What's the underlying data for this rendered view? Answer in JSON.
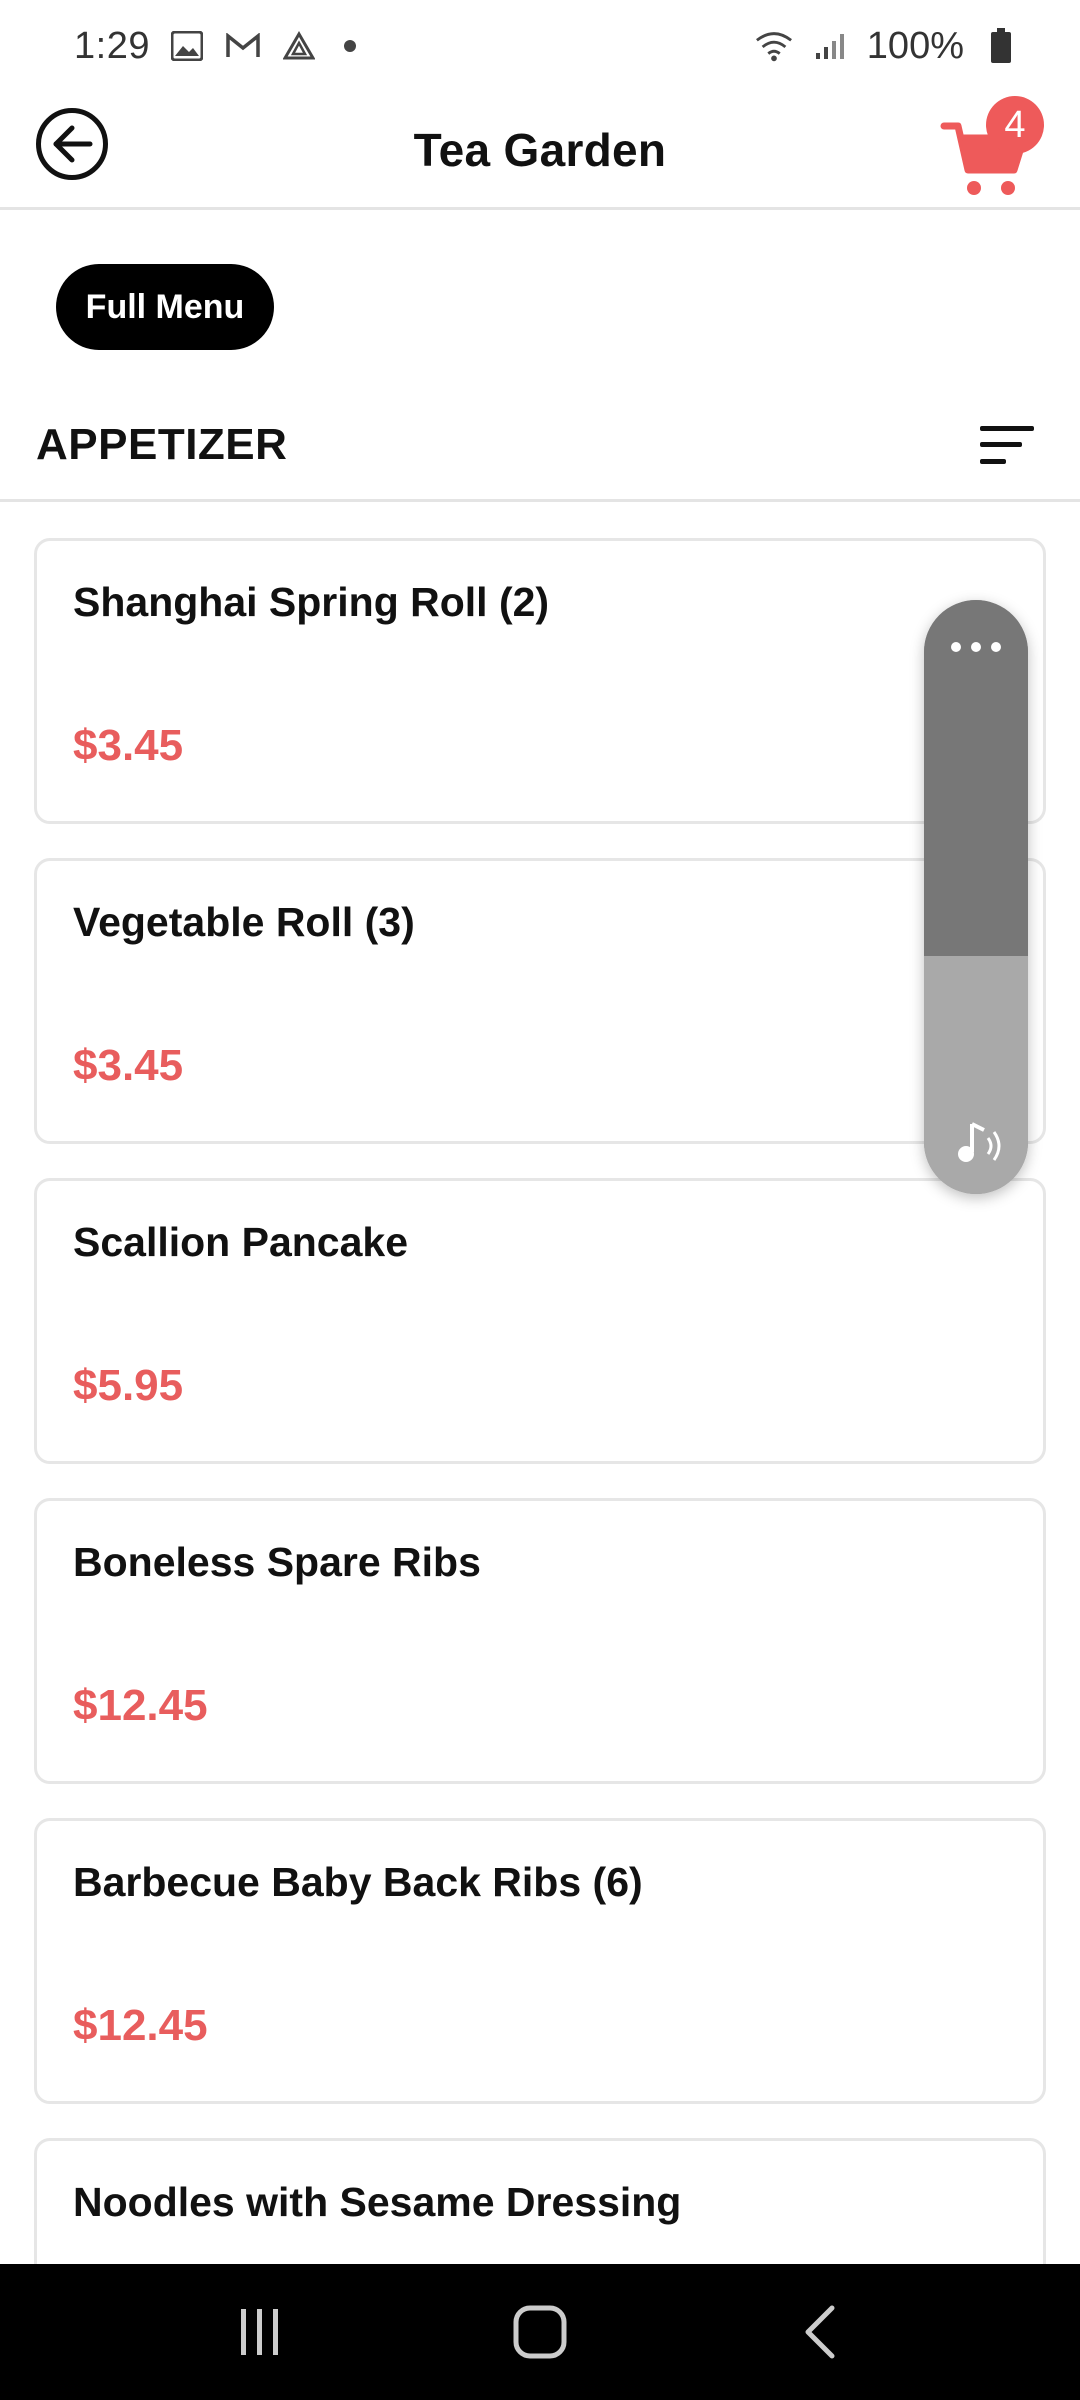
{
  "status_bar": {
    "time": "1:29",
    "battery": "100%",
    "icons": [
      "gallery-icon",
      "gmail-icon",
      "drive-icon",
      "wifi-icon",
      "signal-icon",
      "battery-icon"
    ]
  },
  "header": {
    "title": "Tea Garden",
    "cart_count": "4",
    "accent_color": "#ee5a5a"
  },
  "menu_chip": {
    "label": "Full Menu"
  },
  "section": {
    "title": "APPETIZER"
  },
  "items": [
    {
      "name": "Shanghai Spring Roll (2)",
      "price": "$3.45"
    },
    {
      "name": "Vegetable Roll (3)",
      "price": "$3.45"
    },
    {
      "name": "Scallion Pancake",
      "price": "$5.95"
    },
    {
      "name": "Boneless Spare Ribs",
      "price": "$12.45"
    },
    {
      "name": "Barbecue Baby Back Ribs (6)",
      "price": "$12.45"
    },
    {
      "name": "Noodles with Sesame Dressing",
      "price": ""
    }
  ],
  "price_color": "#e85d5d"
}
